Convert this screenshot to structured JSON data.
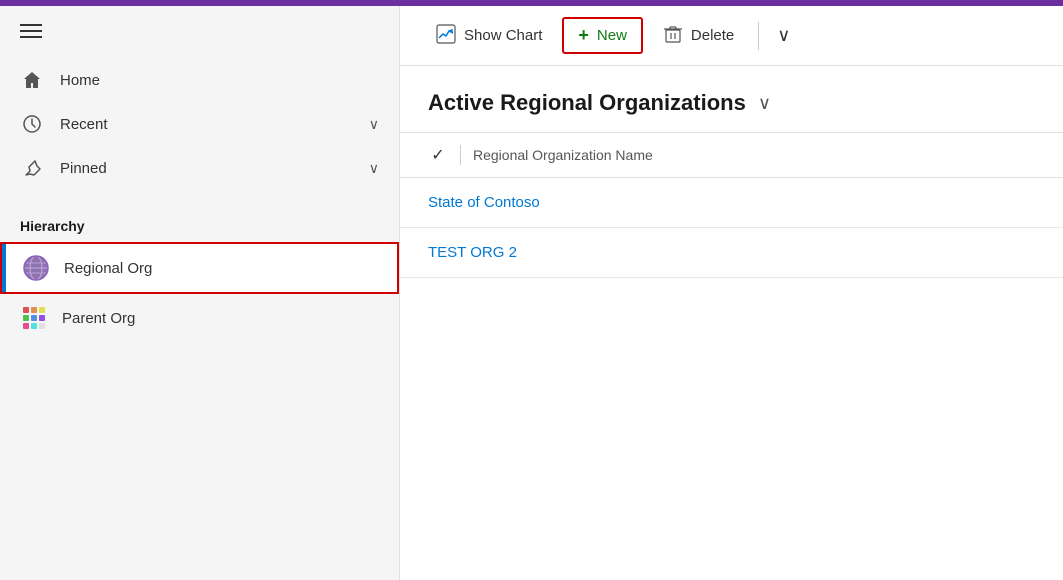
{
  "topBar": {},
  "sidebar": {
    "nav": [
      {
        "id": "home",
        "label": "Home",
        "icon": "home"
      },
      {
        "id": "recent",
        "label": "Recent",
        "icon": "clock",
        "chevron": "∨"
      },
      {
        "id": "pinned",
        "label": "Pinned",
        "icon": "pin",
        "chevron": "∨"
      }
    ],
    "sectionLabel": "Hierarchy",
    "hierarchyItems": [
      {
        "id": "regional-org",
        "label": "Regional Org",
        "iconType": "globe",
        "selected": true
      },
      {
        "id": "parent-org",
        "label": "Parent Org",
        "iconType": "grid",
        "selected": false
      }
    ]
  },
  "toolbar": {
    "showChartLabel": "Show Chart",
    "newLabel": "New",
    "deleteLabel": "Delete",
    "moreLabel": "∨"
  },
  "content": {
    "title": "Active Regional Organizations",
    "titleChevron": "∨",
    "tableHeaderCheck": "✓",
    "tableHeaderLabel": "Regional Organization Name",
    "rows": [
      {
        "id": "row1",
        "label": "State of Contoso"
      },
      {
        "id": "row2",
        "label": "TEST ORG 2"
      }
    ]
  }
}
